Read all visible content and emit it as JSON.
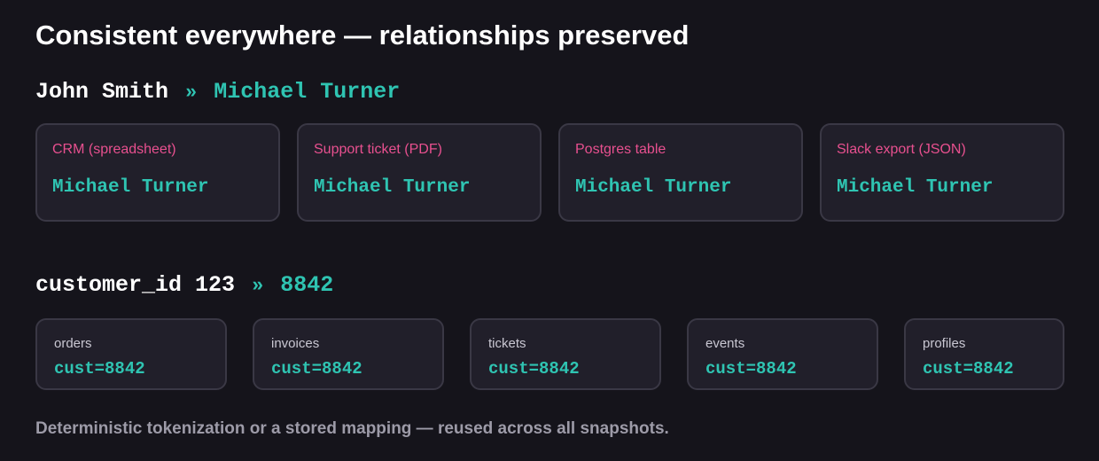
{
  "title": "Consistent everywhere — relationships preserved",
  "name_mapping": {
    "from": "John Smith",
    "arrow": "»",
    "to": "Michael Turner",
    "cards": [
      {
        "label": "CRM (spreadsheet)",
        "value": "Michael Turner"
      },
      {
        "label": "Support ticket (PDF)",
        "value": "Michael Turner"
      },
      {
        "label": "Postgres table",
        "value": "Michael Turner"
      },
      {
        "label": "Slack export (JSON)",
        "value": "Michael Turner"
      }
    ]
  },
  "id_mapping": {
    "from": "customer_id 123",
    "arrow": "»",
    "to": "8842",
    "cards": [
      {
        "label": "orders",
        "value": "cust=8842"
      },
      {
        "label": "invoices",
        "value": "cust=8842"
      },
      {
        "label": "tickets",
        "value": "cust=8842"
      },
      {
        "label": "events",
        "value": "cust=8842"
      },
      {
        "label": "profiles",
        "value": "cust=8842"
      }
    ]
  },
  "footnote": "Deterministic tokenization or a stored mapping — reused across all snapshots.",
  "colors": {
    "background": "#15141b",
    "card_background": "#211f2a",
    "card_border": "#3a3845",
    "accent_teal": "#2fc4b2",
    "accent_pink": "#e8508f"
  }
}
